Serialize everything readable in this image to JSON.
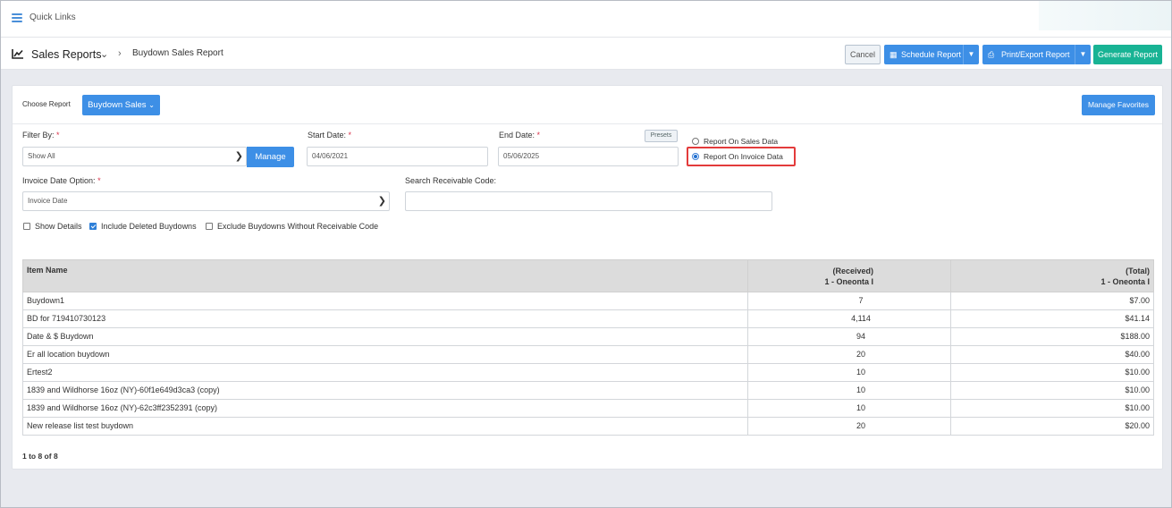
{
  "quick_links": {
    "label": "Quick Links"
  },
  "header": {
    "title": "Sales Reports",
    "breadcrumb": "Buydown Sales Report",
    "buttons": {
      "cancel": "Cancel",
      "schedule": "Schedule Report",
      "print_export": "Print/Export Report",
      "generate": "Generate Report"
    }
  },
  "report_picker": {
    "label": "Choose Report",
    "selected": "Buydown Sales",
    "manage_favorites": "Manage Favorites"
  },
  "filters": {
    "filter_by": {
      "label": "Filter By:",
      "value": "Show All",
      "manage_label": "Manage"
    },
    "start_date": {
      "label": "Start Date:",
      "value": "04/06/2021"
    },
    "end_date": {
      "label": "End Date:",
      "value": "05/06/2025",
      "presets_label": "Presets"
    },
    "report_on": {
      "options": [
        "Report On Sales Data",
        "Report On Invoice Data"
      ],
      "selected": "Report On Invoice Data"
    },
    "invoice_date_option": {
      "label": "Invoice Date Option:",
      "value": "Invoice Date"
    },
    "search_receivable": {
      "label": "Search Receivable Code:",
      "value": ""
    },
    "required_mark": "*",
    "checkboxes": [
      {
        "label": "Show Details",
        "checked": false
      },
      {
        "label": "Include Deleted Buydowns",
        "checked": true
      },
      {
        "label": "Exclude Buydowns Without Receivable Code",
        "checked": false
      }
    ]
  },
  "table": {
    "columns": {
      "item_name": "Item Name",
      "received": {
        "line1": "(Received)",
        "line2": "1 - Oneonta I"
      },
      "total": {
        "line1": "(Total)",
        "line2": "1 - Oneonta I"
      }
    },
    "rows": [
      {
        "name": "Buydown1",
        "received": "7",
        "total": "$7.00"
      },
      {
        "name": "BD for 719410730123",
        "received": "4,114",
        "total": "$41.14"
      },
      {
        "name": "Date & $ Buydown",
        "received": "94",
        "total": "$188.00"
      },
      {
        "name": "Er all location buydown",
        "received": "20",
        "total": "$40.00"
      },
      {
        "name": "Ertest2",
        "received": "10",
        "total": "$10.00"
      },
      {
        "name": "1839 and Wildhorse 16oz (NY)-60f1e649d3ca3 (copy)",
        "received": "10",
        "total": "$10.00"
      },
      {
        "name": "1839 and Wildhorse 16oz (NY)-62c3ff2352391 (copy)",
        "received": "10",
        "total": "$10.00"
      },
      {
        "name": "New release list test buydown",
        "received": "20",
        "total": "$20.00"
      }
    ],
    "pagination": "1 to 8 of 8"
  },
  "colors": {
    "primary_blue": "#3d8fe6",
    "generate_green": "#18b394",
    "highlight_red": "#e33b3b",
    "required_red": "#d9334b"
  }
}
